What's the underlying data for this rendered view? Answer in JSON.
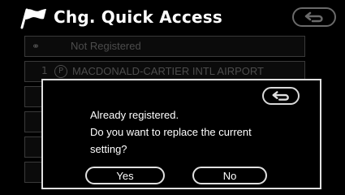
{
  "header": {
    "title": "Chg. Quick Access"
  },
  "list": {
    "rows": [
      {
        "text": "Not Registered"
      },
      {
        "number": "1",
        "badge": "P",
        "text": "MACDONALD-CARTIER INTL AIRPORT"
      }
    ]
  },
  "dialog": {
    "lines": [
      "Already registered.",
      "Do you want to replace the current",
      "setting?"
    ],
    "yes_label": "Yes",
    "no_label": "No"
  }
}
